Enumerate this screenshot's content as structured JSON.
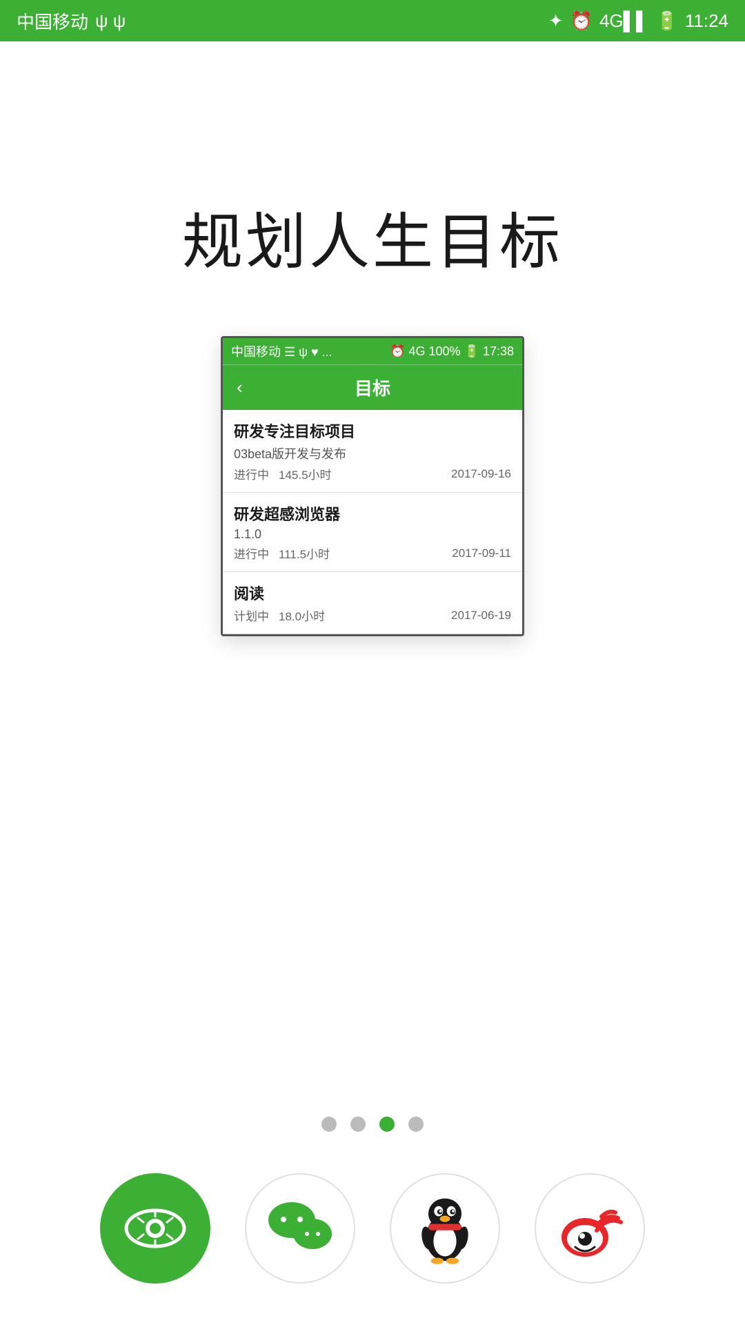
{
  "statusBar": {
    "carrier": "中国移动",
    "icons": "ψ ψ",
    "rightIcons": "⌚ 4G ▌▌",
    "time": "11:24"
  },
  "pageTitle": "规划人生目标",
  "mockup": {
    "statusBar": {
      "left": "中国移动  ☰ ψ ♥ ...",
      "right": "⏰ 4G 100% 🔋 17:38"
    },
    "header": {
      "backLabel": "‹",
      "title": "目标"
    },
    "listItems": [
      {
        "title": "研发专注目标项目",
        "subtitle": "03beta版开发与发布",
        "status": "进行中",
        "hours": "145.5小时",
        "date": "2017-09-16"
      },
      {
        "title": "研发超感浏览器",
        "subtitle": "1.1.0",
        "status": "进行中",
        "hours": "111.5小时",
        "date": "2017-09-11"
      },
      {
        "title": "阅读",
        "subtitle": "",
        "status": "计划中",
        "hours": "18.0小时",
        "date": "2017-06-19"
      }
    ]
  },
  "pagination": {
    "dots": [
      {
        "active": false
      },
      {
        "active": false
      },
      {
        "active": true
      },
      {
        "active": false
      }
    ]
  },
  "bottomIcons": [
    {
      "name": "app-icon",
      "type": "eye",
      "bg": "green"
    },
    {
      "name": "wechat-icon",
      "type": "wechat",
      "bg": "white"
    },
    {
      "name": "qq-icon",
      "type": "qq",
      "bg": "white"
    },
    {
      "name": "weibo-icon",
      "type": "weibo",
      "bg": "white"
    }
  ]
}
